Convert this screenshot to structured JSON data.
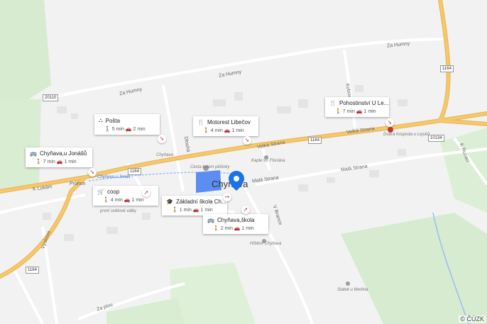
{
  "roads": {
    "za_humny_1": "Za Humny",
    "za_humny_2": "Za Humny",
    "za_humny_3": "Za Humny",
    "velka_strana_1": "Velká Strana",
    "velka_strana_2": "Velká Strana",
    "mala_strana_1": "Malá Strana",
    "mala_strana_2": "Malá Strana",
    "k_lukam": "K Lukám",
    "pruhon": "Průhon",
    "v_brance": "V Brance",
    "kobova": "Kobova",
    "za_piou": "Za piou",
    "vyskova": "Výskova",
    "k_ruzaci": "K Ruzaci",
    "dlouha": "Dlouhá"
  },
  "road_numbers": [
    "1164",
    "1164",
    "1164",
    "20110",
    "10134",
    "1164"
  ],
  "places": {
    "town": "Chyňava",
    "kaple": "Kaple sv. Floriána",
    "hrbitov": "Hřbitov Chyňava",
    "statek": "Statek u Merlina",
    "stop_label": "Chyňava u Jonáš",
    "church": "Cesta kolem pěšinky",
    "hospoda": "Dobrá hospoda u Lejsků",
    "pripojeni": "první světové války",
    "chynava_small": "Chyňava"
  },
  "cards": [
    {
      "name": "Chyňava,u Jonášů",
      "icon": "bus",
      "walk": "7 min",
      "drive": "1 min"
    },
    {
      "name": "Pošta",
      "icon": "post",
      "walk": "5 min",
      "drive": "2 min"
    },
    {
      "name": "Motorest Libečov",
      "icon": "restaurant",
      "walk": "4 min",
      "drive": "1 min"
    },
    {
      "name": "Pohostinství U Le...",
      "icon": "restaurant",
      "walk": "7 min",
      "drive": "1 min"
    },
    {
      "name": "coop",
      "icon": "cart",
      "walk": "4 min",
      "drive": "1 min"
    },
    {
      "name": "Základní škola Ch...",
      "icon": "school",
      "walk": "1 min",
      "drive": "1 min"
    },
    {
      "name": "Chyňava,škola",
      "icon": "bus",
      "walk": "2 min",
      "drive": "1 min"
    }
  ],
  "credit": "© ČÚZK",
  "colors": {
    "major_road": "#f7c86a",
    "pin": "#1a73e8",
    "water": "#5b8ef0",
    "forest": "#cde6c7"
  }
}
